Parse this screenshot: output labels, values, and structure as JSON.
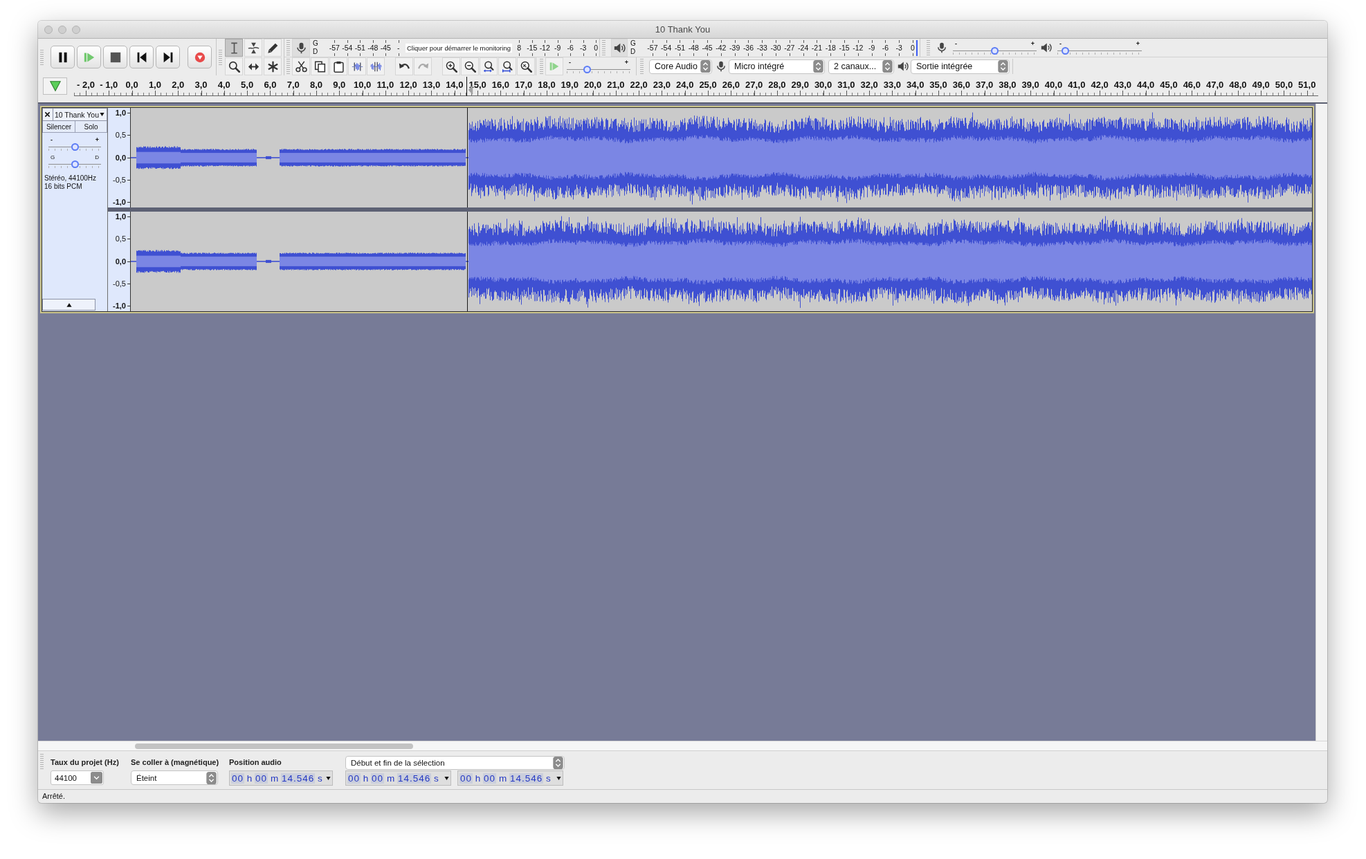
{
  "window": {
    "title": "10 Thank You"
  },
  "tools": [
    {
      "kind": "ibeam",
      "selected": true
    },
    {
      "kind": "envelope",
      "selected": false
    },
    {
      "kind": "draw",
      "selected": false
    },
    {
      "kind": "zoom",
      "selected": false
    },
    {
      "kind": "timeshift",
      "selected": false
    },
    {
      "kind": "multi",
      "selected": false
    }
  ],
  "record_meter": {
    "channels": [
      "G",
      "D"
    ],
    "ticks_before": [
      "-57",
      "-54",
      "-51",
      "-48",
      "-45",
      "-"
    ],
    "prompt": "Cliquer pour démarrer le monitoring",
    "ticks_after": [
      "8",
      "-15",
      "-12",
      "-9",
      "-6",
      "-3",
      "0"
    ]
  },
  "playback_meter": {
    "channels": [
      "G",
      "D"
    ],
    "ticks": [
      "-57",
      "-54",
      "-51",
      "-48",
      "-45",
      "-42",
      "-39",
      "-36",
      "-33",
      "-30",
      "-27",
      "-24",
      "-21",
      "-18",
      "-15",
      "-12",
      "-9",
      "-6",
      "-3",
      "0"
    ]
  },
  "mixer": [
    {
      "kind": "input",
      "min_label": "-",
      "max_label": "+",
      "level": 0.5
    },
    {
      "kind": "output",
      "min_label": "-",
      "max_label": "+",
      "level": 0.05
    }
  ],
  "history": [
    {
      "kind": "undo",
      "disabled": false
    },
    {
      "kind": "redo",
      "disabled": true
    }
  ],
  "play_at_speed": {
    "min_label": "-",
    "max_label": "+",
    "level": 0.3
  },
  "devices": [
    {
      "kind": "host",
      "value": "Core Audio"
    },
    {
      "kind": "input",
      "value": "Micro intégré"
    },
    {
      "kind": "channels",
      "value": "2 canaux..."
    },
    {
      "kind": "output",
      "value": "Sortie intégrée"
    }
  ],
  "ruler": {
    "labels": [
      "- 2,0",
      "- 1,0",
      "0,0",
      "1,0",
      "2,0",
      "3,0",
      "4,0",
      "5,0",
      "6,0",
      "7,0",
      "8,0",
      "9,0",
      "10,0",
      "11,0",
      "12,0",
      "13,0",
      "14,0",
      "15,0",
      "16,0",
      "17,0",
      "18,0",
      "19,0",
      "20,0",
      "21,0",
      "22,0",
      "23,0",
      "24,0",
      "25,0",
      "26,0",
      "27,0",
      "28,0",
      "29,0",
      "30,0",
      "31,0",
      "32,0",
      "33,0",
      "34,0",
      "35,0",
      "36,0",
      "37,0",
      "38,0",
      "39,0",
      "40,0",
      "41,0",
      "42,0",
      "43,0",
      "44,0",
      "45,0",
      "46,0",
      "47,0",
      "48,0",
      "49,0",
      "50,0",
      "51,0"
    ]
  },
  "track": {
    "name": "10 Thank You",
    "buttons": [
      "Silencer",
      "Solo"
    ],
    "gain": {
      "min_label": "-",
      "max_label": "+",
      "level": 0.5
    },
    "pan": {
      "min_label": "G",
      "max_label": "D",
      "level": 0.5
    },
    "info": [
      "Stéréo, 44100Hz",
      "16 bits PCM"
    ],
    "channels": [
      {
        "scale": [
          "1,0",
          "0,5",
          "0,0",
          "-0,5",
          "-1,0"
        ]
      },
      {
        "scale": [
          "1,0",
          "0,5",
          "0,0",
          "-0,5",
          "-1,0"
        ]
      }
    ]
  },
  "selection_bar": {
    "rate": {
      "label": "Taux du projet (Hz)",
      "value": "44100"
    },
    "snap": {
      "label": "Se coller à (magnétique)",
      "value": "Éteint"
    },
    "position": {
      "label": "Position audio",
      "value": "00 h 00 m 14.546 s"
    },
    "selection": {
      "mode": "Début et fin de la sélection",
      "start": "00 h 00 m 14.546 s",
      "end": "00 h 00 m 14.546 s"
    }
  },
  "status_bar": {
    "text": "Arrêté."
  }
}
